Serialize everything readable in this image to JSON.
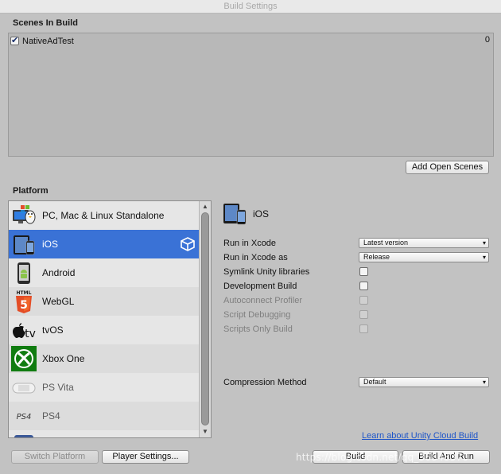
{
  "window": {
    "title": "Build Settings"
  },
  "scenes": {
    "header": "Scenes In Build",
    "items": [
      {
        "name": "NativeAdTest",
        "index": "0",
        "checked": true
      }
    ],
    "add_open_scenes": "Add Open Scenes"
  },
  "platform": {
    "header": "Platform",
    "items": [
      {
        "label": "PC, Mac & Linux Standalone",
        "icon": "pc-standalone-icon"
      },
      {
        "label": "iOS",
        "icon": "ios-device-icon",
        "selected": true
      },
      {
        "label": "Android",
        "icon": "android-icon"
      },
      {
        "label": "WebGL",
        "icon": "html5-icon"
      },
      {
        "label": "tvOS",
        "icon": "apple-tv-icon"
      },
      {
        "label": "Xbox One",
        "icon": "xbox-icon"
      },
      {
        "label": "PS Vita",
        "icon": "ps-vita-icon"
      },
      {
        "label": "PS4",
        "icon": "ps4-icon"
      }
    ]
  },
  "settings": {
    "platform_name": "iOS",
    "run_in_xcode": {
      "label": "Run in Xcode",
      "value": "Latest version"
    },
    "run_in_xcode_as": {
      "label": "Run in Xcode as",
      "value": "Release"
    },
    "symlink": {
      "label": "Symlink Unity libraries",
      "checked": false
    },
    "development_build": {
      "label": "Development Build",
      "checked": false
    },
    "autoconnect_profiler": {
      "label": "Autoconnect Profiler",
      "checked": false,
      "disabled": true
    },
    "script_debugging": {
      "label": "Script Debugging",
      "checked": false,
      "disabled": true
    },
    "scripts_only_build": {
      "label": "Scripts Only Build",
      "checked": false,
      "disabled": true
    },
    "compression": {
      "label": "Compression Method",
      "value": "Default"
    }
  },
  "footer": {
    "cloud_build_link": "Learn about Unity Cloud Build",
    "switch_platform": "Switch Platform",
    "player_settings": "Player Settings...",
    "build": "Build",
    "build_and_run": "Build And Run",
    "watermark": "https://blog.csdn.net/qq_36848370"
  },
  "colors": {
    "selection": "#3a72d6",
    "window_bg": "#c2c2c2",
    "link": "#1e55c8"
  }
}
